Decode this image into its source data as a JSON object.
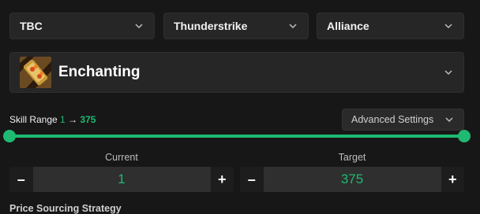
{
  "filters": {
    "expansion": "TBC",
    "realm": "Thunderstrike",
    "faction": "Alliance"
  },
  "profession": {
    "name": "Enchanting",
    "icon": "enchanting-scroll-icon"
  },
  "skill_range": {
    "label": "Skill Range",
    "min": "1",
    "arrow": "→",
    "max": "375"
  },
  "advanced_settings": {
    "label": "Advanced Settings"
  },
  "current": {
    "label": "Current",
    "value": "1",
    "minus": "–",
    "plus": "+"
  },
  "target": {
    "label": "Target",
    "value": "375",
    "minus": "–",
    "plus": "+"
  },
  "next_section": {
    "label": "Price Sourcing Strategy"
  },
  "colors": {
    "accent": "#1fba72",
    "background": "#171717",
    "panel": "#262626"
  }
}
